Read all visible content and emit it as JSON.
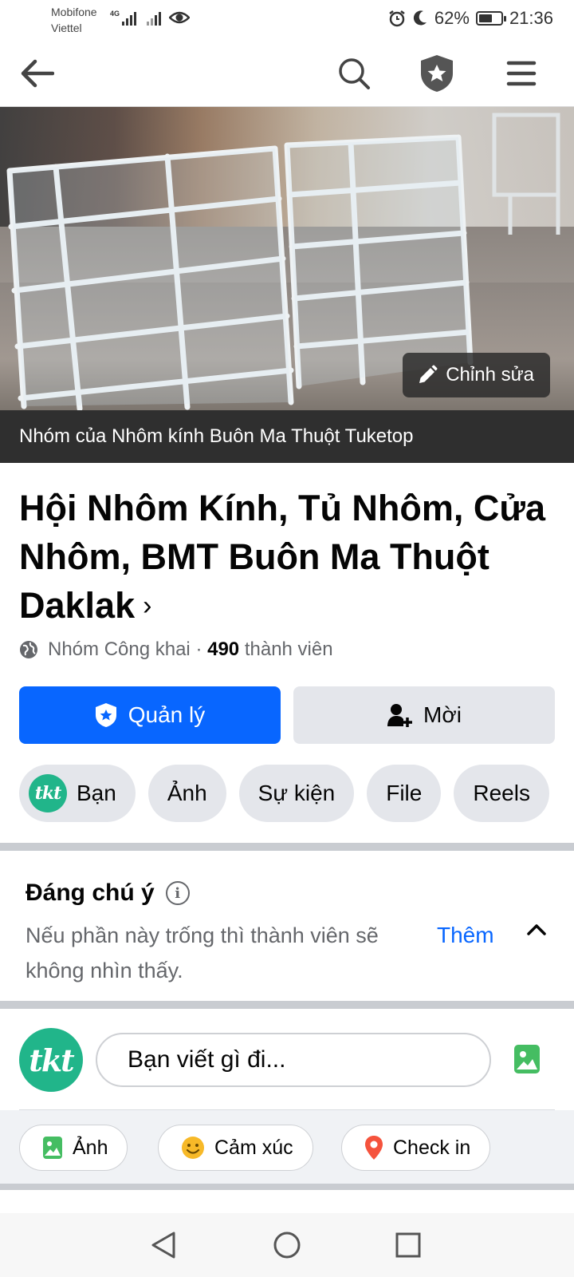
{
  "status_bar": {
    "carrier1": "Mobifone",
    "carrier2": "Viettel",
    "network_tag": "4G",
    "battery": "62%",
    "battery_level": 0.62,
    "time": "21:36"
  },
  "nav": {
    "back_icon": "arrow-left-icon",
    "search_icon": "search-icon",
    "admin_icon": "shield-star-icon",
    "menu_icon": "hamburger-menu-icon"
  },
  "cover": {
    "edit_label": "Chỉnh sửa",
    "owner_caption": "Nhóm của Nhôm kính Buôn Ma Thuột Tuketop"
  },
  "group": {
    "title": "Hội Nhôm Kính, Tủ Nhôm, Cửa Nhôm, BMT Buôn Ma Thuột Daklak",
    "chevron": "›",
    "privacy": "Nhóm Công khai",
    "dot": "·",
    "member_count": "490",
    "member_label": "thành viên"
  },
  "actions": {
    "manage_label": "Quản lý",
    "invite_label": "Mời"
  },
  "chips": [
    {
      "label": "Bạn",
      "avatar_text": "tkt"
    },
    {
      "label": "Ảnh"
    },
    {
      "label": "Sự kiện"
    },
    {
      "label": "File"
    },
    {
      "label": "Reels"
    }
  ],
  "featured": {
    "title": "Đáng chú ý",
    "info": "i",
    "description": "Nếu phần này trống thì thành viên sẽ không nhìn thấy.",
    "more_label": "Thêm"
  },
  "composer": {
    "avatar_text": "tkt",
    "placeholder": "Bạn viết gì đi..."
  },
  "post_actions": [
    {
      "label": "Ảnh",
      "icon": "photo-icon"
    },
    {
      "label": "Cảm xúc",
      "icon": "smile-icon"
    },
    {
      "label": "Check in",
      "icon": "location-pin-icon"
    }
  ],
  "colors": {
    "primary": "#0866ff",
    "chip_bg": "#e4e6eb",
    "avatar_green": "#21b58a"
  }
}
